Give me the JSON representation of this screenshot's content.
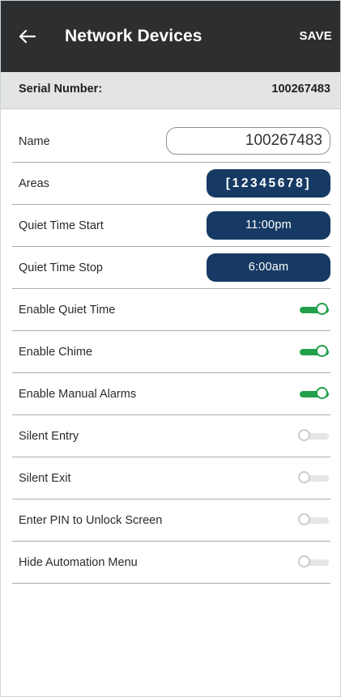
{
  "appbar": {
    "back_icon": "arrow-left-icon",
    "title": "Network Devices",
    "save_label": "SAVE"
  },
  "serial": {
    "label": "Serial Number:",
    "value": "100267483"
  },
  "colors": {
    "appbar_bg": "#2d2e30",
    "accent_blue": "#163a63",
    "toggle_on": "#22a04b",
    "toggle_off": "#e4e6e7"
  },
  "fields": {
    "name": {
      "label": "Name",
      "value": "100267483"
    },
    "areas": {
      "label": "Areas",
      "value": "[12345678]"
    },
    "quiet_start": {
      "label": "Quiet Time Start",
      "value": "11:00pm"
    },
    "quiet_stop": {
      "label": "Quiet Time Stop",
      "value": "6:00am"
    }
  },
  "toggles": [
    {
      "label": "Enable Quiet Time",
      "on": true
    },
    {
      "label": "Enable Chime",
      "on": true
    },
    {
      "label": "Enable Manual Alarms",
      "on": true
    },
    {
      "label": "Silent Entry",
      "on": false
    },
    {
      "label": "Silent Exit",
      "on": false
    },
    {
      "label": "Enter PIN to Unlock Screen",
      "on": false
    },
    {
      "label": "Hide Automation Menu",
      "on": false
    }
  ]
}
